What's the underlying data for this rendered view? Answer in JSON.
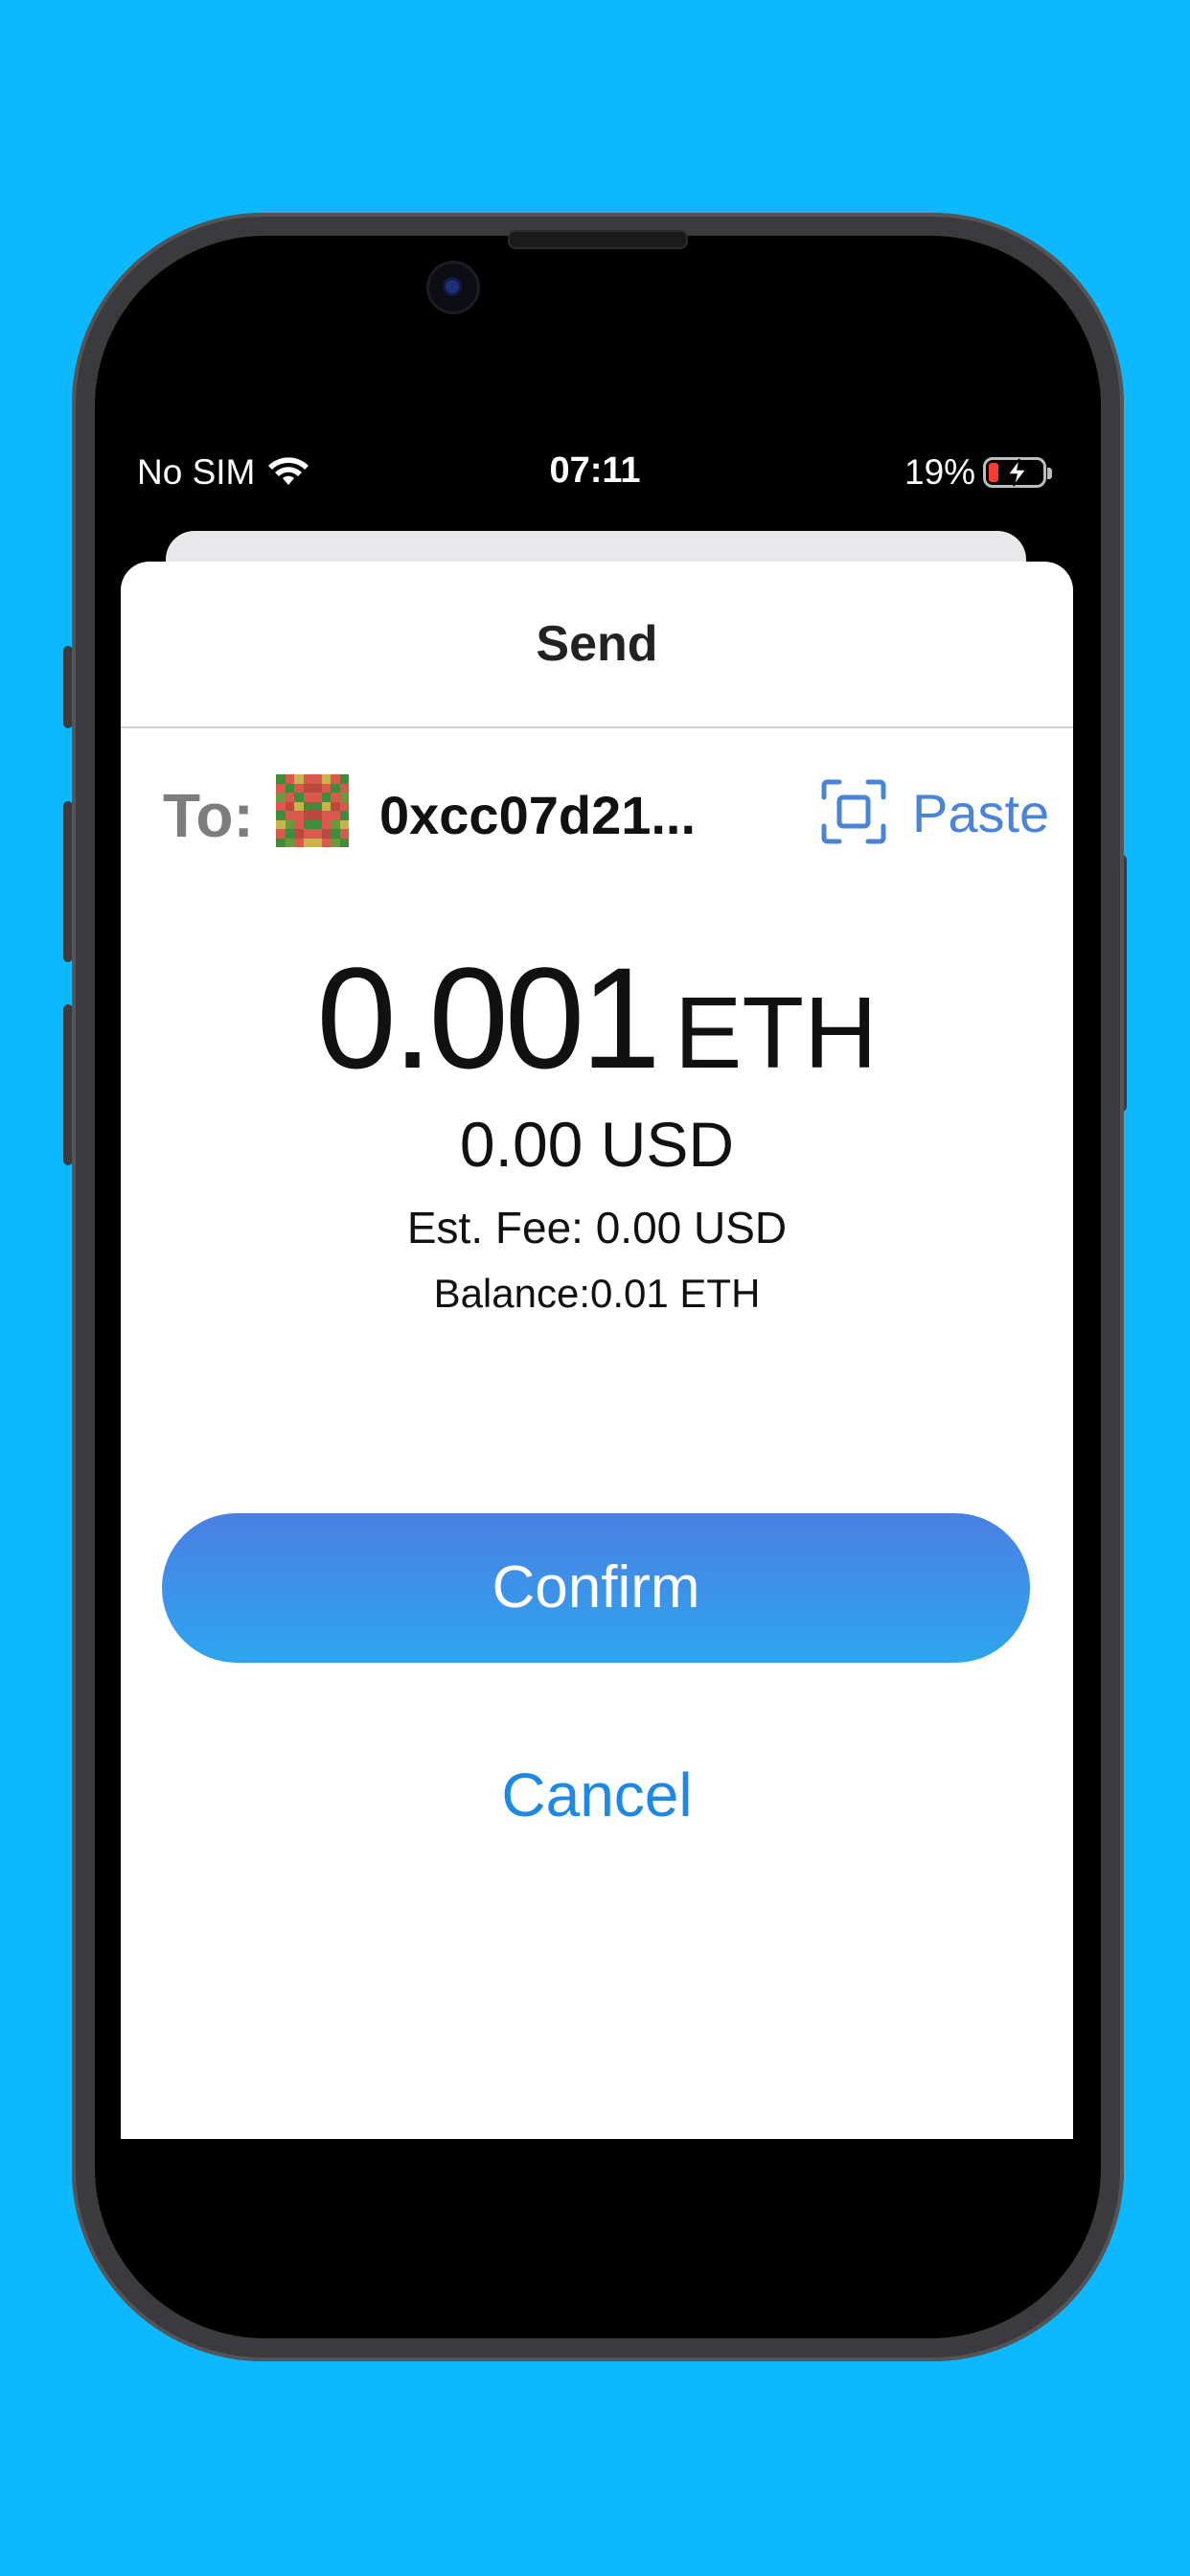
{
  "status_bar": {
    "carrier": "No SIM",
    "time": "07:11",
    "battery_percent": "19%",
    "battery_level": 0.19,
    "battery_color": "#ff3b30",
    "wifi_icon": "wifi-icon",
    "charging_icon": "bolt-icon"
  },
  "sheet": {
    "title": "Send"
  },
  "recipient": {
    "label": "To:",
    "address": "0xcc07d21...",
    "avatar_icon": "identicon-avatar",
    "scan_icon": "qr-scan-icon",
    "paste_label": "Paste"
  },
  "amount": {
    "value": "0.001",
    "unit": "ETH",
    "fiat": "0.00 USD",
    "fee": "Est. Fee: 0.00 USD",
    "balance": "Balance:0.01 ETH"
  },
  "actions": {
    "confirm_label": "Confirm",
    "cancel_label": "Cancel"
  },
  "colors": {
    "background": "#0db8fe",
    "accent": "#4a84d8",
    "cancel": "#1e88e5",
    "confirm_gradient_top": "#4a7fe4",
    "confirm_gradient_bottom": "#2ea5ef"
  }
}
